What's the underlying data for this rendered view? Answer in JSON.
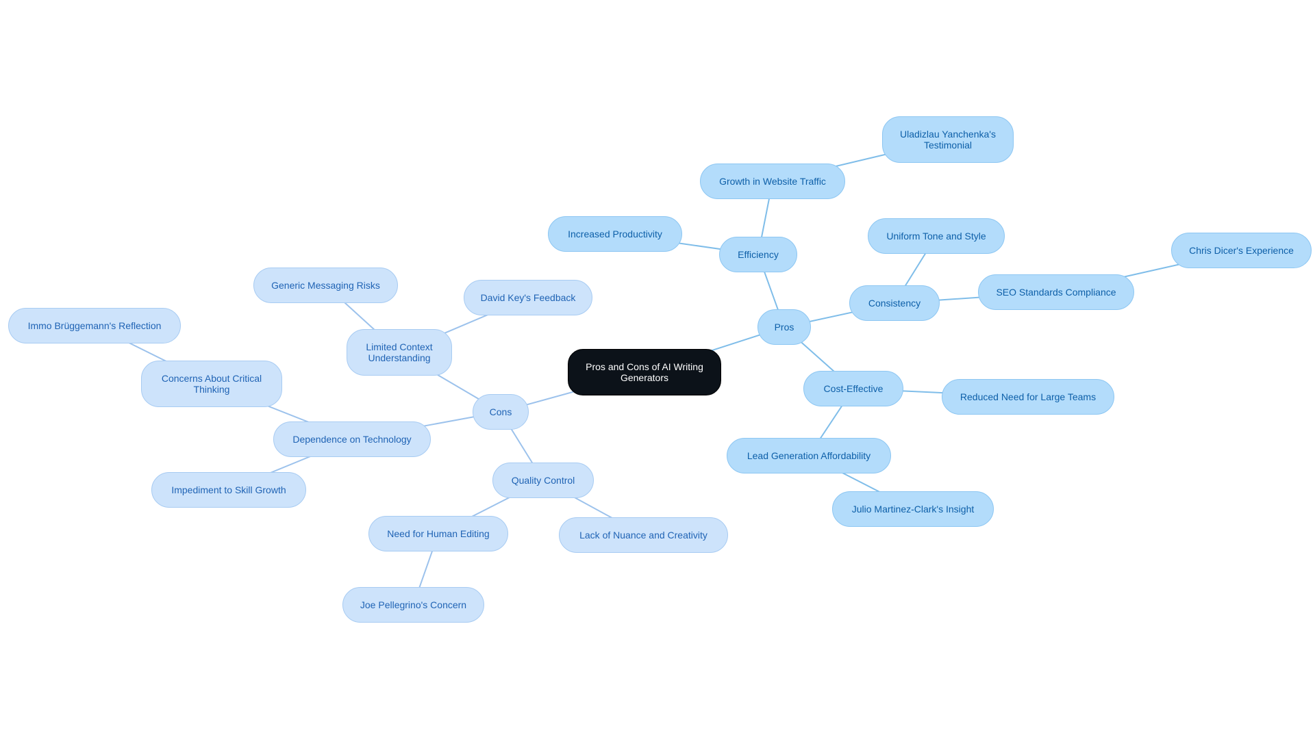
{
  "diagram": {
    "type": "mindmap",
    "root": {
      "id": "root",
      "label": "Pros and Cons of AI Writing Generators"
    },
    "colors": {
      "root_fill": "#0c1219",
      "pros_fill": "#b3dcfb",
      "cons_fill": "#cde3fb",
      "pros_edge": "#7fbde9",
      "cons_edge": "#9cc2ec",
      "text": "#1565b0"
    },
    "nodes": [
      {
        "id": "pros",
        "label": "Pros",
        "parent": "root",
        "branch": "pros"
      },
      {
        "id": "efficiency",
        "label": "Efficiency",
        "parent": "pros",
        "branch": "pros"
      },
      {
        "id": "growth",
        "label": "Growth in Website Traffic",
        "parent": "efficiency",
        "branch": "pros"
      },
      {
        "id": "uladzislau",
        "label": "Uladizlau Yanchenka's Testimonial",
        "parent": "growth",
        "branch": "pros"
      },
      {
        "id": "productivity",
        "label": "Increased Productivity",
        "parent": "efficiency",
        "branch": "pros"
      },
      {
        "id": "consistency",
        "label": "Consistency",
        "parent": "pros",
        "branch": "pros"
      },
      {
        "id": "uniform",
        "label": "Uniform Tone and Style",
        "parent": "consistency",
        "branch": "pros"
      },
      {
        "id": "seo",
        "label": "SEO Standards Compliance",
        "parent": "consistency",
        "branch": "pros"
      },
      {
        "id": "dicer",
        "label": "Chris Dicer's Experience",
        "parent": "seo",
        "branch": "pros"
      },
      {
        "id": "cost",
        "label": "Cost-Effective",
        "parent": "pros",
        "branch": "pros"
      },
      {
        "id": "teams",
        "label": "Reduced Need for Large Teams",
        "parent": "cost",
        "branch": "pros"
      },
      {
        "id": "lead",
        "label": "Lead Generation Affordability",
        "parent": "cost",
        "branch": "pros"
      },
      {
        "id": "julio",
        "label": "Julio Martinez-Clark's Insight",
        "parent": "lead",
        "branch": "pros"
      },
      {
        "id": "cons",
        "label": "Cons",
        "parent": "root",
        "branch": "cons"
      },
      {
        "id": "limited",
        "label": "Limited Context Understanding",
        "parent": "cons",
        "branch": "cons"
      },
      {
        "id": "generic",
        "label": "Generic Messaging Risks",
        "parent": "limited",
        "branch": "cons"
      },
      {
        "id": "david",
        "label": "David Key's Feedback",
        "parent": "limited",
        "branch": "cons"
      },
      {
        "id": "dependence",
        "label": "Dependence on Technology",
        "parent": "cons",
        "branch": "cons"
      },
      {
        "id": "critical",
        "label": "Concerns About Critical Thinking",
        "parent": "dependence",
        "branch": "cons"
      },
      {
        "id": "immo",
        "label": "Immo Brüggemann's Reflection",
        "parent": "critical",
        "branch": "cons"
      },
      {
        "id": "skill",
        "label": "Impediment to Skill Growth",
        "parent": "dependence",
        "branch": "cons"
      },
      {
        "id": "quality",
        "label": "Quality Control",
        "parent": "cons",
        "branch": "cons"
      },
      {
        "id": "editing",
        "label": "Need for Human Editing",
        "parent": "quality",
        "branch": "cons"
      },
      {
        "id": "joe",
        "label": "Joe Pellegrino's Concern",
        "parent": "editing",
        "branch": "cons"
      },
      {
        "id": "nuance",
        "label": "Lack of Nuance and Creativity",
        "parent": "quality",
        "branch": "cons"
      }
    ]
  }
}
